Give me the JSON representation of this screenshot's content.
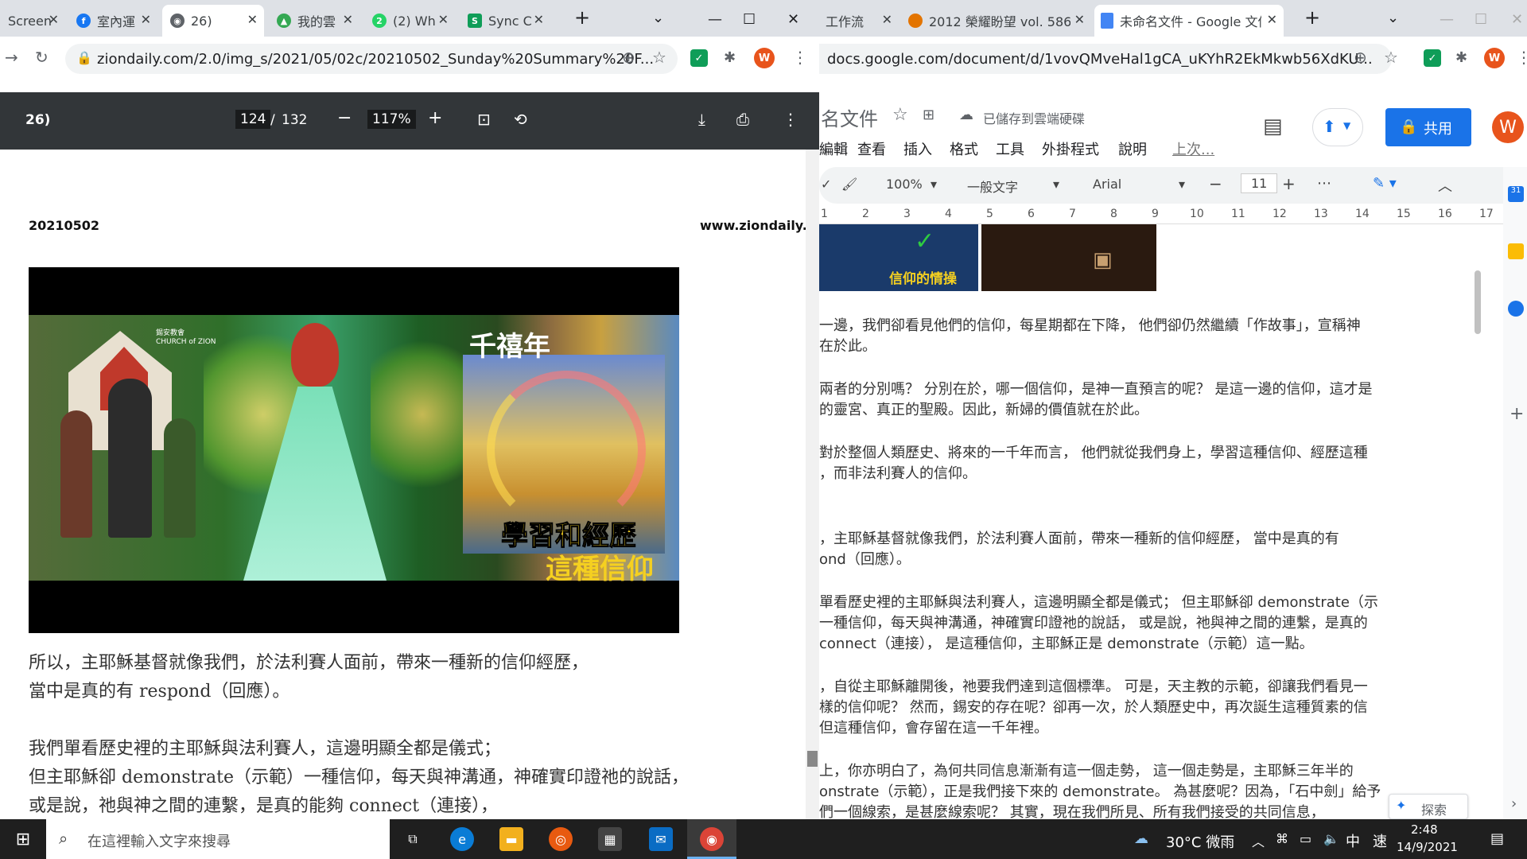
{
  "left_window": {
    "tabs": [
      {
        "title": "Screen",
        "icon": "screen-icon",
        "color": "#1a73e8"
      },
      {
        "title": "室內運",
        "icon": "facebook-icon",
        "color": "#1877f2"
      },
      {
        "title": "26)",
        "icon": "globe-icon",
        "color": "#5f6368"
      },
      {
        "title": "我的雲",
        "icon": "google-drive-icon",
        "color": "#34a853"
      },
      {
        "title": "(2) Wh",
        "icon": "whatsapp-icon",
        "color": "#25d366"
      },
      {
        "title": "Sync C",
        "icon": "sync-icon",
        "color": "#0f9d58"
      }
    ],
    "url": "ziondaily.com/2.0/img_s/2021/05/02c/20210502_Sunday%20Summary%20F...",
    "pdf": {
      "title": "26)",
      "page_current": "124",
      "page_separator": "/",
      "page_total": "132",
      "zoom": "117%",
      "date_header": "20210502",
      "site_header": "www.ziondaily.c",
      "image": {
        "heading": "千禧年",
        "caption_line1": "學習和經歷",
        "caption_line2": "這種信仰",
        "church_logo_text": "錫安教會\nCHURCH of ZION"
      },
      "paragraphs": [
        "所以，主耶穌基督就像我們，於法利賽人面前，帶來一種新的信仰經歷，",
        "當中是真的有 respond（回應）。",
        "",
        "我們單看歷史裡的主耶穌與法利賽人，這邊明顯全都是儀式；",
        "但主耶穌卻 demonstrate（示範）一種信仰，每天與神溝通，神確實印證祂的說話，",
        "或是說，祂與神之間的連繫，是真的能夠 connect（連接），"
      ]
    }
  },
  "right_window": {
    "tabs": [
      {
        "title": "工作流",
        "icon": "doc-icon",
        "color": "#1a73e8"
      },
      {
        "title": "2012 榮耀盼望 vol. 586 -",
        "icon": "pizza-icon",
        "color": "#e37400"
      },
      {
        "title": "未命名文件 - Google 文件",
        "icon": "google-docs-icon",
        "color": "#4285f4"
      }
    ],
    "url": "docs.google.com/document/d/1vovQMveHal1gCA_uKYhR2EkMkwb56XdKU...",
    "doc_title": "名文件",
    "saved_status": "已儲存到雲端硬碟",
    "share_label": "共用",
    "user_initial": "W",
    "menu": [
      "編輯",
      "查看",
      "插入",
      "格式",
      "工具",
      "外掛程式",
      "說明",
      "上次..."
    ],
    "toolbar": {
      "zoom": "100%",
      "style": "一般文字",
      "font": "Arial",
      "font_size": "11"
    },
    "ruler": [
      "1",
      "2",
      "3",
      "4",
      "5",
      "6",
      "7",
      "8",
      "9",
      "10",
      "11",
      "12",
      "13",
      "14",
      "15",
      "16",
      "17"
    ],
    "image_caption": "信仰的情操",
    "lines": [
      "一邊，我們卻看見他們的信仰，每星期都在下降， 他們卻仍然繼續「作故事」，宣稱神",
      "在於此。",
      "",
      "兩者的分別嗎？ 分別在於，哪一個信仰，是神一直預言的呢？ 是這一邊的信仰，這才是",
      "的靈宮、真正的聖殿。因此，新婦的價值就在於此。",
      "",
      "對於整個人類歷史、將來的一千年而言， 他們就從我們身上，學習這種信仰、經歷這種",
      "，而非法利賽人的信仰。",
      "",
      "",
      "，主耶穌基督就像我們，於法利賽人面前，帶來一種新的信仰經歷， 當中是真的有",
      "ond（回應）。",
      "",
      "單看歷史裡的主耶穌與法利賽人，這邊明顯全都是儀式； 但主耶穌卻 demonstrate（示",
      "一種信仰，每天與神溝通，神確實印證祂的說話， 或是說，祂與神之間的連繫，是真的",
      " connect（連接）， 是這種信仰，主耶穌正是 demonstrate（示範）這一點。",
      "",
      "，自從主耶穌離開後，祂要我們達到這個標準。 可是，天主教的示範，卻讓我們看見一",
      "樣的信仰呢？ 然而，錫安的存在呢？卻再一次，於人類歷史中，再次誕生這種質素的信",
      "但這種信仰，會存留在這一千年裡。",
      "",
      "上，你亦明白了，為何共同信息漸漸有這一個走勢， 這一個走勢是，主耶穌三年半的",
      "onstrate（示範），正是我們接下來的 demonstrate。 為甚麼呢？因為，「石中劍」給予",
      "們一個線索，是甚麼線索呢？ 其實，現在我們所見、所有我們接受的共同信息，"
    ],
    "explore_label": "探索"
  },
  "taskbar": {
    "search_placeholder": "在這裡輸入文字來搜尋",
    "weather": "30°C 微雨",
    "ime": "中",
    "ime2": "速",
    "time": "2:48",
    "date": "14/9/2021"
  }
}
